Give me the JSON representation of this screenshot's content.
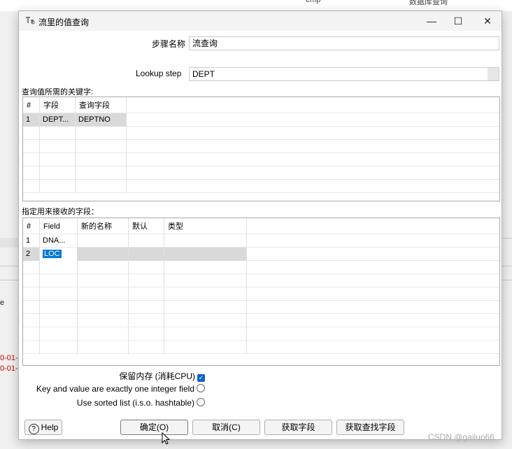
{
  "background": {
    "top_snippets": [
      "emp",
      "数据库查询"
    ],
    "left_snippets": [
      "e",
      "0-01-",
      "0-01-"
    ]
  },
  "window": {
    "title": "流里的值查询",
    "controls": {
      "minimize": "—",
      "maximize": "☐",
      "close": "✕"
    }
  },
  "form": {
    "step_name_label": "步骤名称",
    "step_name_value": "流查询",
    "lookup_step_label": "Lookup step",
    "lookup_step_value": "DEPT"
  },
  "keys_section": {
    "title": "查询值所需的关键字:",
    "columns": [
      "#",
      "字段",
      "查询字段"
    ],
    "rows": [
      {
        "num": "1",
        "field": "DEPT...",
        "lookup_field": "DEPTNO"
      }
    ]
  },
  "fields_section": {
    "title": "指定用来接收的字段：",
    "columns": [
      "#",
      "Field",
      "新的名称",
      "默认",
      "类型"
    ],
    "rows": [
      {
        "num": "1",
        "field": "DNA...",
        "new_name": "",
        "default": "",
        "type": ""
      },
      {
        "num": "2",
        "field": "LOC",
        "new_name": "",
        "default": "",
        "type": ""
      }
    ]
  },
  "options": {
    "preserve_memory_label": "保留内存 (消耗CPU)",
    "preserve_memory_checked": true,
    "integer_pair_label": "Key and value are exactly one integer field",
    "integer_pair_checked": false,
    "sorted_list_label": "Use sorted list (i.s.o. hashtable)",
    "sorted_list_checked": false
  },
  "buttons": {
    "help": "Help",
    "ok": "确定(O)",
    "cancel": "取消(C)",
    "get_fields": "获取字段",
    "get_lookup_fields": "获取查找字段"
  },
  "icons": {
    "window_icon": "stream-lookup-icon",
    "help_icon": "help-circle-icon",
    "check_icon": "check-icon"
  },
  "watermark": "CSDN @gailun66"
}
